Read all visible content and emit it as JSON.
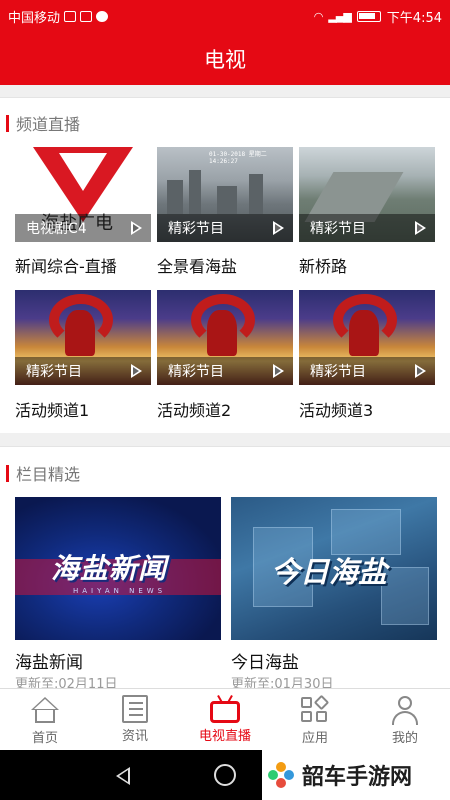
{
  "status_bar": {
    "carrier": "中国移动",
    "time": "下午4:54"
  },
  "header": {
    "title": "电视"
  },
  "channels_section": {
    "title": "频道直播",
    "items": [
      {
        "tag": "电视剧C4",
        "caption": "新闻综合-直播",
        "thumb": "logo",
        "logo_text": "海盐广电"
      },
      {
        "tag": "精彩节目",
        "caption": "全景看海盐",
        "thumb": "city",
        "timestamp": "01-30-2018 星期二 14:26:27"
      },
      {
        "tag": "精彩节目",
        "caption": "新桥路",
        "thumb": "road"
      },
      {
        "tag": "精彩节目",
        "caption": "活动频道1",
        "thumb": "event"
      },
      {
        "tag": "精彩节目",
        "caption": "活动频道2",
        "thumb": "event"
      },
      {
        "tag": "精彩节目",
        "caption": "活动频道3",
        "thumb": "event"
      }
    ]
  },
  "programs_section": {
    "title": "栏目精选",
    "items": [
      {
        "title": "海盐新闻",
        "update": "更新至:02月11日",
        "logo_text": "海盐新闻",
        "logo_sub": "HAIYAN NEWS"
      },
      {
        "title": "今日海盐",
        "update": "更新至:01月30日",
        "logo_text": "今日海盐"
      }
    ]
  },
  "bottom_nav": {
    "items": [
      {
        "label": "首页",
        "icon": "home-icon"
      },
      {
        "label": "资讯",
        "icon": "news-icon"
      },
      {
        "label": "电视直播",
        "icon": "tv-icon",
        "active": true
      },
      {
        "label": "应用",
        "icon": "apps-icon"
      },
      {
        "label": "我的",
        "icon": "user-icon"
      }
    ]
  },
  "watermark": {
    "text": "韶车手游网"
  },
  "colors": {
    "accent": "#e50914",
    "text": "#111111",
    "muted": "#9a9a9a"
  }
}
